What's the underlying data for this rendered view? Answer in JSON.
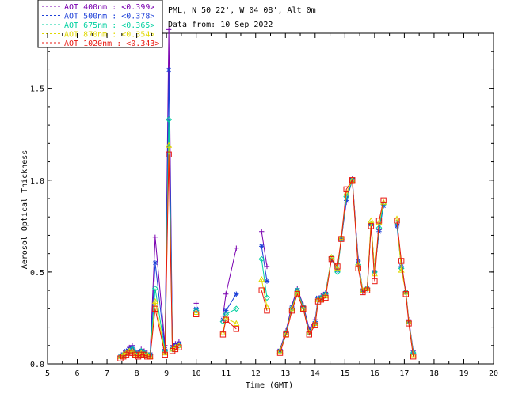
{
  "chart_data": {
    "type": "line",
    "title": "",
    "xlabel": "Time (GMT)",
    "ylabel": "Aerosol Optical Thickness",
    "xlim": [
      5,
      20
    ],
    "ylim": [
      0,
      1.8
    ],
    "x_ticks": [
      5,
      6,
      7,
      8,
      9,
      10,
      11,
      12,
      13,
      14,
      15,
      16,
      17,
      18,
      19,
      20
    ],
    "y_ticks": [
      0.0,
      0.5,
      1.0,
      1.5
    ],
    "grid": false,
    "legend_position": "top-left outside",
    "annotations": [
      "PML, N 50 22', W 04 08', Alt 0m",
      "Data from: 10 Sep 2022"
    ],
    "x": [
      7.45,
      7.55,
      7.65,
      7.75,
      7.85,
      7.95,
      8.05,
      8.15,
      8.25,
      8.35,
      8.45,
      8.62,
      8.95,
      9.08,
      9.2,
      9.3,
      9.42,
      10.0,
      10.9,
      11.0,
      11.35,
      12.2,
      12.38,
      12.82,
      13.02,
      13.22,
      13.4,
      13.6,
      13.8,
      14.0,
      14.1,
      14.2,
      14.35,
      14.55,
      14.75,
      14.88,
      15.05,
      15.25,
      15.45,
      15.6,
      15.75,
      15.88,
      16.0,
      16.15,
      16.3,
      16.75,
      16.9,
      17.05,
      17.15,
      17.3
    ],
    "series": [
      {
        "name": "AOT  400nm : <0.399>",
        "color": "#7a00b0",
        "marker": "plus",
        "values": [
          0.04,
          0.06,
          0.07,
          0.09,
          0.1,
          0.07,
          0.06,
          0.08,
          0.07,
          0.06,
          0.06,
          0.69,
          0.1,
          1.82,
          0.1,
          0.11,
          0.12,
          0.33,
          0.26,
          0.38,
          0.63,
          0.72,
          0.53,
          0.08,
          0.18,
          0.32,
          0.41,
          0.32,
          0.19,
          0.24,
          0.36,
          0.37,
          0.39,
          0.57,
          0.51,
          0.68,
          0.88,
          1.01,
          0.57,
          0.39,
          0.41,
          0.76,
          0.5,
          0.73,
          0.86,
          0.76,
          0.55,
          0.39,
          0.24,
          0.07
        ]
      },
      {
        "name": "AOT  500nm : <0.378>",
        "color": "#1c3fd8",
        "marker": "star",
        "values": [
          0.04,
          0.05,
          0.07,
          0.08,
          0.09,
          0.06,
          0.06,
          0.07,
          0.06,
          0.05,
          0.05,
          0.55,
          0.08,
          1.6,
          0.09,
          0.1,
          0.11,
          0.3,
          0.24,
          0.29,
          0.38,
          0.64,
          0.45,
          0.07,
          0.17,
          0.31,
          0.4,
          0.31,
          0.18,
          0.23,
          0.36,
          0.36,
          0.38,
          0.57,
          0.51,
          0.68,
          0.89,
          1.0,
          0.56,
          0.4,
          0.41,
          0.76,
          0.5,
          0.72,
          0.86,
          0.75,
          0.53,
          0.39,
          0.23,
          0.06
        ]
      },
      {
        "name": "AOT  675nm : <0.365>",
        "color": "#00d0a0",
        "marker": "diamond",
        "values": [
          0.04,
          0.05,
          0.06,
          0.07,
          0.08,
          0.06,
          0.05,
          0.07,
          0.06,
          0.05,
          0.05,
          0.41,
          0.07,
          1.33,
          0.08,
          0.09,
          0.1,
          0.29,
          0.23,
          0.27,
          0.3,
          0.57,
          0.36,
          0.07,
          0.17,
          0.3,
          0.4,
          0.31,
          0.17,
          0.22,
          0.35,
          0.36,
          0.38,
          0.58,
          0.5,
          0.68,
          0.91,
          1.0,
          0.54,
          0.4,
          0.41,
          0.76,
          0.5,
          0.74,
          0.87,
          0.77,
          0.52,
          0.39,
          0.23,
          0.06
        ]
      },
      {
        "name": "AOT  870nm : <0.354>",
        "color": "#e0d800",
        "marker": "triangle",
        "values": [
          0.04,
          0.05,
          0.06,
          0.07,
          0.07,
          0.05,
          0.05,
          0.06,
          0.05,
          0.05,
          0.04,
          0.34,
          0.06,
          1.19,
          0.08,
          0.09,
          0.1,
          0.28,
          0.17,
          0.25,
          0.22,
          0.46,
          0.31,
          0.07,
          0.16,
          0.3,
          0.39,
          0.3,
          0.17,
          0.22,
          0.35,
          0.35,
          0.37,
          0.58,
          0.52,
          0.69,
          0.93,
          1.0,
          0.54,
          0.4,
          0.41,
          0.78,
          0.49,
          0.77,
          0.88,
          0.79,
          0.51,
          0.39,
          0.23,
          0.05
        ]
      },
      {
        "name": "AOT 1020nm : <0.343>",
        "color": "#e81810",
        "marker": "square",
        "values": [
          0.03,
          0.04,
          0.05,
          0.06,
          0.06,
          0.05,
          0.04,
          0.05,
          0.05,
          0.04,
          0.04,
          0.3,
          0.05,
          1.14,
          0.07,
          0.08,
          0.09,
          0.27,
          0.16,
          0.24,
          0.19,
          0.4,
          0.29,
          0.06,
          0.16,
          0.29,
          0.38,
          0.3,
          0.16,
          0.21,
          0.34,
          0.35,
          0.36,
          0.57,
          0.53,
          0.68,
          0.95,
          1.0,
          0.52,
          0.39,
          0.4,
          0.75,
          0.45,
          0.78,
          0.89,
          0.78,
          0.56,
          0.38,
          0.22,
          0.04
        ]
      }
    ]
  }
}
